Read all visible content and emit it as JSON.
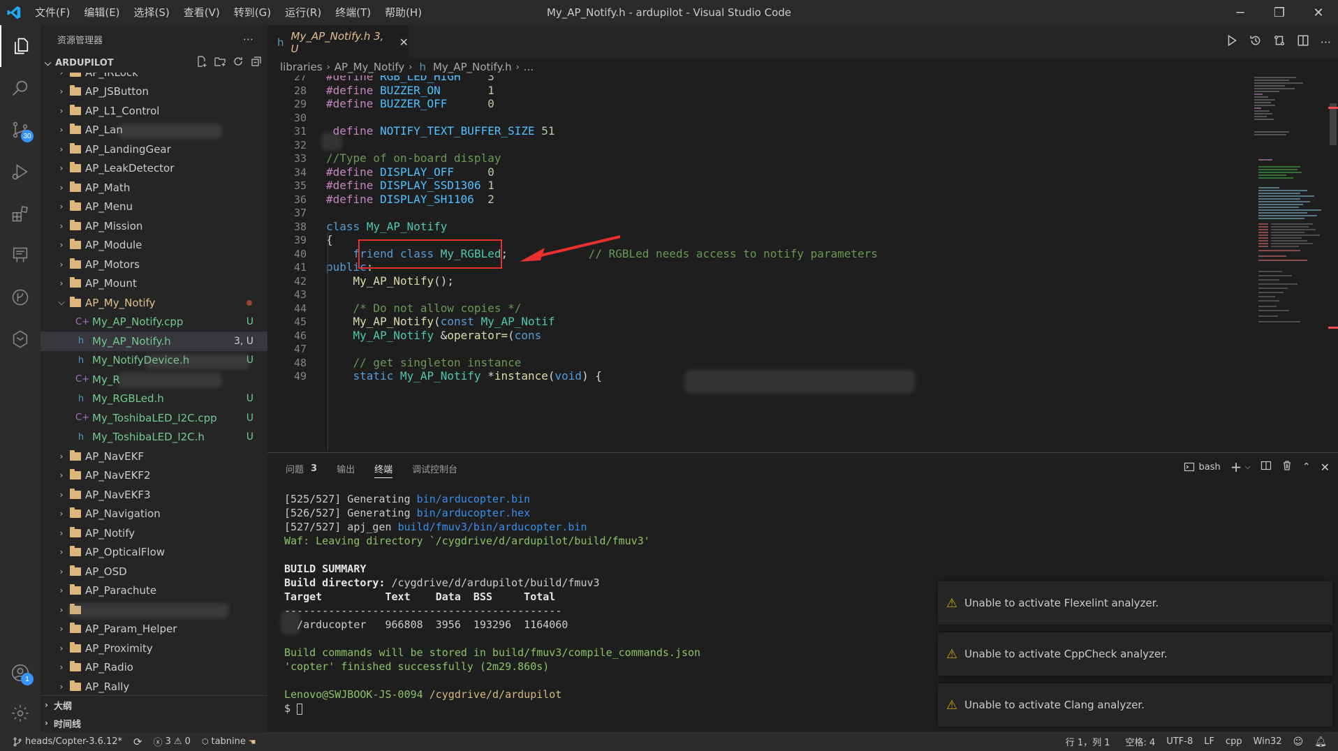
{
  "titlebar": {
    "menus": [
      "文件(F)",
      "编辑(E)",
      "选择(S)",
      "查看(V)",
      "转到(G)",
      "运行(R)",
      "终端(T)",
      "帮助(H)"
    ],
    "window_title": "My_AP_Notify.h - ardupilot - Visual Studio Code"
  },
  "activitybar": {
    "scm_badge": "30",
    "account_badge": "1"
  },
  "sidebar": {
    "title": "资源管理器",
    "section": "ARDUPILOT",
    "tree": [
      {
        "type": "folder",
        "label": "AP_IRLock",
        "level": 1
      },
      {
        "type": "folder",
        "label": "AP_JSButton",
        "level": 1
      },
      {
        "type": "folder",
        "label": "AP_L1_Control",
        "level": 1
      },
      {
        "type": "folder",
        "label": "AP_Lan",
        "level": 1
      },
      {
        "type": "folder",
        "label": "AP_LandingGear",
        "level": 1
      },
      {
        "type": "folder",
        "label": "AP_LeakDetector",
        "level": 1
      },
      {
        "type": "folder",
        "label": "AP_Math",
        "level": 1
      },
      {
        "type": "folder",
        "label": "AP_Menu",
        "level": 1
      },
      {
        "type": "folder",
        "label": "AP_Mission",
        "level": 1
      },
      {
        "type": "folder",
        "label": "AP_Module",
        "level": 1
      },
      {
        "type": "folder",
        "label": "AP_Motors",
        "level": 1
      },
      {
        "type": "folder",
        "label": "AP_Mount",
        "level": 1
      },
      {
        "type": "folder-open",
        "label": "AP_My_Notify",
        "level": 1
      },
      {
        "type": "cpp",
        "label": "My_AP_Notify.cpp",
        "status": "U",
        "level": 2
      },
      {
        "type": "h",
        "label": "My_AP_Notify.h",
        "status": "3, U",
        "level": 2
      },
      {
        "type": "h",
        "label": "My_NotifyDevice.h",
        "status": "U",
        "level": 2
      },
      {
        "type": "cpp",
        "label": "My_R",
        "status": "",
        "level": 2
      },
      {
        "type": "h",
        "label": "My_RGBLed.h",
        "status": "U",
        "level": 2
      },
      {
        "type": "cpp",
        "label": "My_ToshibaLED_I2C.cpp",
        "status": "U",
        "level": 2
      },
      {
        "type": "h",
        "label": "My_ToshibaLED_I2C.h",
        "status": "U",
        "level": 2
      },
      {
        "type": "folder",
        "label": "AP_NavEKF",
        "level": 1
      },
      {
        "type": "folder",
        "label": "AP_NavEKF2",
        "level": 1
      },
      {
        "type": "folder",
        "label": "AP_NavEKF3",
        "level": 1
      },
      {
        "type": "folder",
        "label": "AP_Navigation",
        "level": 1
      },
      {
        "type": "folder",
        "label": "AP_Notify",
        "level": 1
      },
      {
        "type": "folder",
        "label": "AP_OpticalFlow",
        "level": 1
      },
      {
        "type": "folder",
        "label": "AP_OSD",
        "level": 1
      },
      {
        "type": "folder",
        "label": "AP_Parachute",
        "level": 1
      },
      {
        "type": "folder",
        "label": "",
        "level": 1
      },
      {
        "type": "folder",
        "label": "AP_Param_Helper",
        "level": 1
      },
      {
        "type": "folder",
        "label": "AP_Proximity",
        "level": 1
      },
      {
        "type": "folder",
        "label": "AP_Radio",
        "level": 1
      },
      {
        "type": "folder",
        "label": "AP_Rally",
        "level": 1
      }
    ],
    "outline": "大纲",
    "timeline": "时间线"
  },
  "editor": {
    "tab_label": "My_AP_Notify.h 3, U",
    "breadcrumb": [
      "libraries",
      "AP_My_Notify",
      "My_AP_Notify.h",
      "..."
    ]
  },
  "code": [
    {
      "n": "27",
      "html": "<span class='pre'>#define</span> <span class='mac'>RGB_LED_HIGH</span>    <span class='num'>3</span>"
    },
    {
      "n": "28",
      "html": "<span class='pre'>#define</span> <span class='mac'>BUZZER_ON</span>       <span class='num'>1</span>"
    },
    {
      "n": "29",
      "html": "<span class='pre'>#define</span> <span class='mac'>BUZZER_OFF</span>      <span class='num'>0</span>"
    },
    {
      "n": "30",
      "html": ""
    },
    {
      "n": "31",
      "html": " <span class='pre'>define</span> <span class='mac'>NOTIFY_TEXT_BUFFER_SIZE</span> <span class='num'>51</span>"
    },
    {
      "n": "32",
      "html": ""
    },
    {
      "n": "33",
      "html": "<span class='cmt'>//Type of on-board display</span>"
    },
    {
      "n": "34",
      "html": "<span class='pre'>#define</span> <span class='mac'>DISPLAY_OFF</span>     <span class='num'>0</span>"
    },
    {
      "n": "35",
      "html": "<span class='pre'>#define</span> <span class='mac'>DISPLAY_SSD1306</span> <span class='num'>1</span>"
    },
    {
      "n": "36",
      "html": "<span class='pre'>#define</span> <span class='mac'>DISPLAY_SH1106</span>  <span class='num'>2</span>"
    },
    {
      "n": "37",
      "html": ""
    },
    {
      "n": "38",
      "html": "<span class='kw2'>class</span> <span class='typ'>My_AP_Notify</span>"
    },
    {
      "n": "39",
      "html": "{"
    },
    {
      "n": "40",
      "html": "    <span class='kw2'>friend</span> <span class='kw2'>class</span> <span class='typ'>My_RGBLed</span>;            <span class='cmt'>// RGBLed needs access to notify parameters</span>"
    },
    {
      "n": "41",
      "html": "<span class='kw2'>public</span>:"
    },
    {
      "n": "42",
      "html": "    <span class='fn'>My_AP_Notify</span>();"
    },
    {
      "n": "43",
      "html": ""
    },
    {
      "n": "44",
      "html": "    <span class='cmt'>/* Do not allow copies */</span>"
    },
    {
      "n": "45",
      "html": "    <span class='fn'>My_AP_Notify</span>(<span class='kw2'>const</span> <span class='typ'>My_AP_Notif</span>"
    },
    {
      "n": "46",
      "html": "    <span class='typ'>My_AP_Notify</span> &amp;<span class='fn'>operator=</span>(<span class='kw2'>cons</span>"
    },
    {
      "n": "47",
      "html": ""
    },
    {
      "n": "48",
      "html": "    <span class='cmt'>// get singleton instance</span>"
    },
    {
      "n": "49",
      "html": "    <span class='kw2'>static</span> <span class='typ'>My_AP_Notify</span> *<span class='fn'>instance</span>(<span class='kw2'>void</span>) {"
    }
  ],
  "panel": {
    "tabs": [
      "问题",
      "输出",
      "终端",
      "调试控制台"
    ],
    "problems_count": "3",
    "shell": "bash"
  },
  "terminal": [
    {
      "html": "[525/527] Generating <span class='t-blue'>bin/arducopter.bin</span>"
    },
    {
      "html": "[526/527] Generating <span class='t-blue'>bin/arducopter.hex</span>"
    },
    {
      "html": "[527/527] apj_gen <span class='t-blue'>build/fmuv3/bin/arducopter.bin</span>"
    },
    {
      "html": "<span class='t-green'>Waf: Leaving directory `/cygdrive/d/ardupilot/build/fmuv3'</span>"
    },
    {
      "html": ""
    },
    {
      "html": "<span class='t-bold'>BUILD SUMMARY</span>"
    },
    {
      "html": "<span class='t-bold'>Build directory: </span>/cygdrive/d/ardupilot/build/fmuv3"
    },
    {
      "html": "<span class='t-bold'>Target          Text    Data  BSS     Total</span>"
    },
    {
      "html": "<span class='t-sep'>--------------------------------------------</span>"
    },
    {
      "html": "  /arducopter   966808  3956  193296  1164060"
    },
    {
      "html": ""
    },
    {
      "html": "<span class='t-green'>Build commands will be stored in build/fmuv3/compile_commands.json</span>"
    },
    {
      "html": "<span class='t-green'>'copter' finished successfully (2m29.860s)</span>"
    },
    {
      "html": ""
    },
    {
      "html": "<span class='t-green'>Lenovo@SWJBOOK-JS-0094</span> <span style='color:#d7ba7d'>/cygdrive/d/ardupilot</span>"
    },
    {
      "html": "$ <span style='display:inline-block;width:8px;height:16px;border:1px solid #cccccc;vertical-align:middle'></span>"
    }
  ],
  "notifications": [
    "Unable to activate Flexelint analyzer.",
    "Unable to activate CppCheck analyzer.",
    "Unable to activate Clang analyzer."
  ],
  "statusbar": {
    "branch": "heads/Copter-3.6.12*",
    "errors": "3",
    "warnings": "0",
    "tabnine": "tabnine",
    "position": "行 1，列 1",
    "spaces": "空格: 4",
    "encoding": "UTF-8",
    "eol": "LF",
    "language": "cpp",
    "platform": "Win32"
  }
}
